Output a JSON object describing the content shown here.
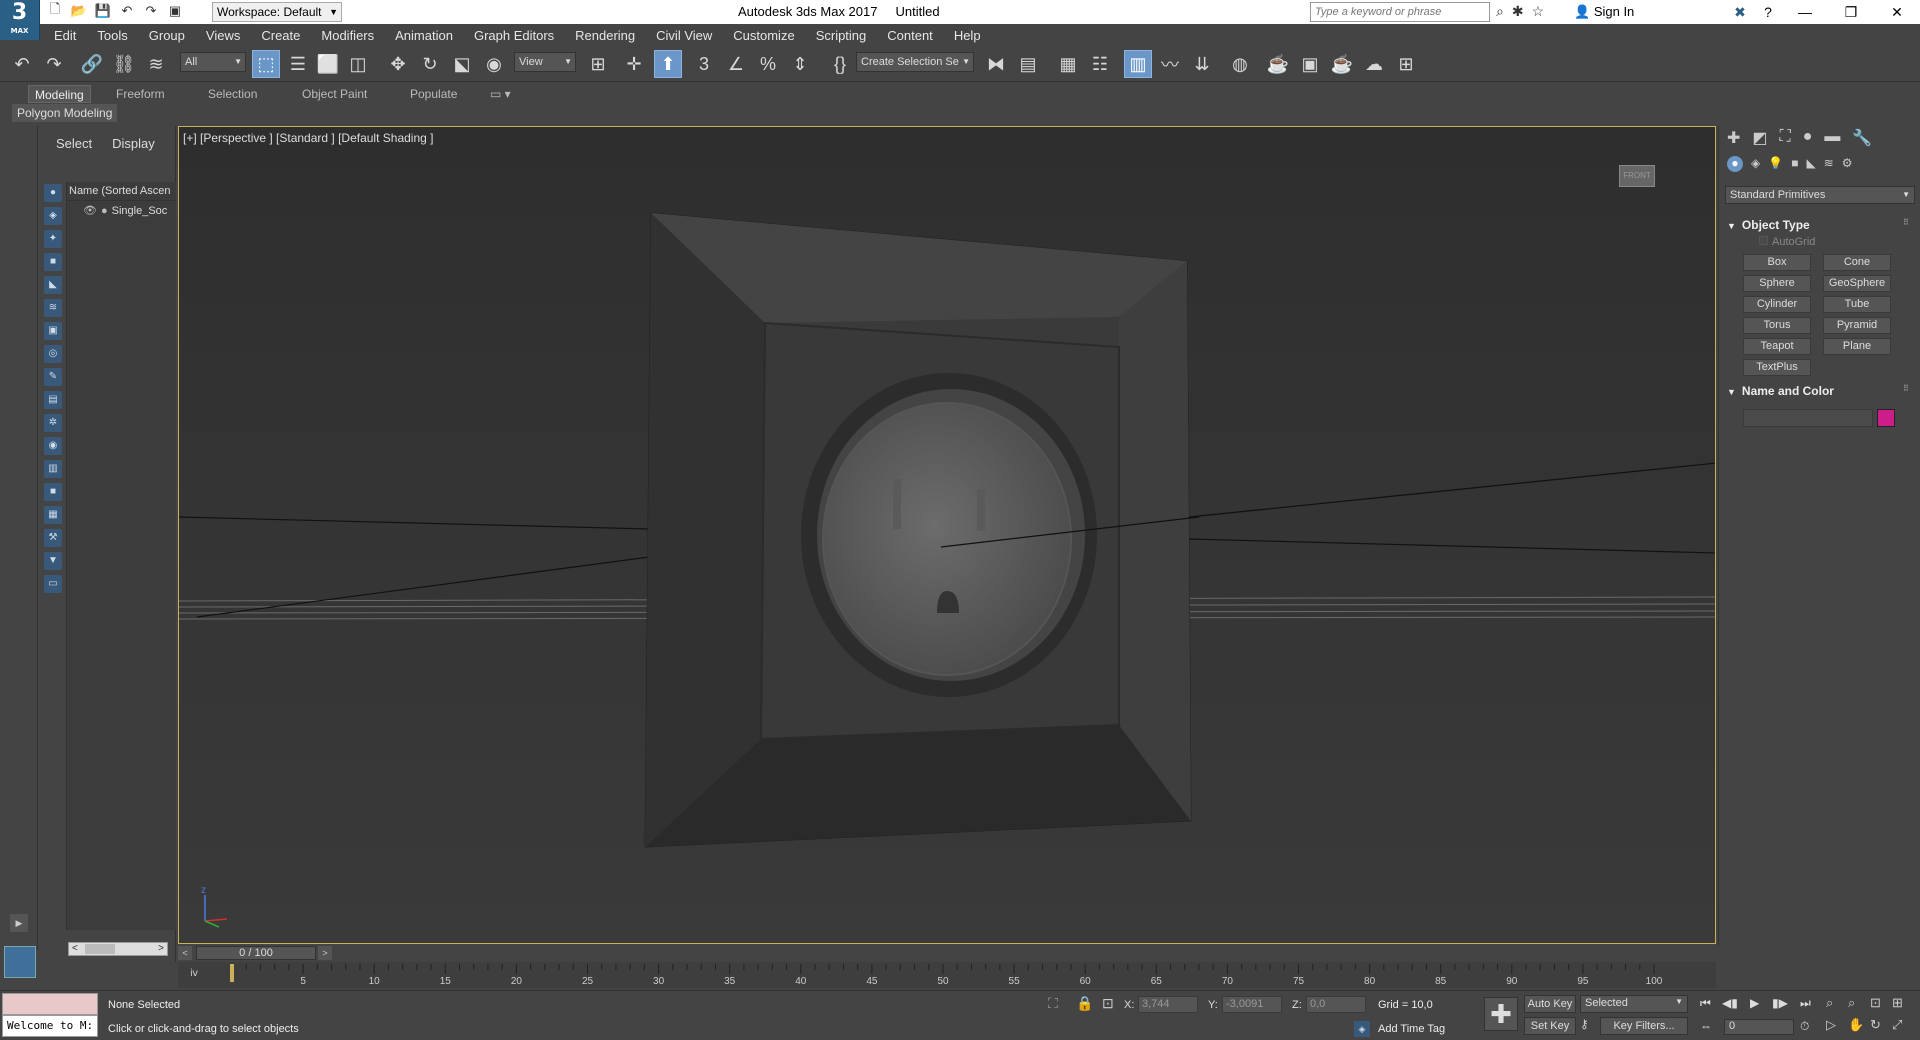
{
  "title_bar": {
    "logo_big": "3",
    "logo_small": "MAX",
    "workspace": "Workspace: Default",
    "app_title": "Autodesk 3ds Max 2017",
    "doc_title": "Untitled",
    "search_placeholder": "Type a keyword or phrase",
    "sign_in": "Sign In"
  },
  "menu": [
    "Edit",
    "Tools",
    "Group",
    "Views",
    "Create",
    "Modifiers",
    "Animation",
    "Graph Editors",
    "Rendering",
    "Civil View",
    "Customize",
    "Scripting",
    "Content",
    "Help"
  ],
  "toolbar": {
    "filter": "All",
    "ref_coord": "View",
    "selection_set": "Create Selection Se"
  },
  "ribbon": {
    "tabs": [
      "Modeling",
      "Freeform",
      "Selection",
      "Object Paint",
      "Populate"
    ],
    "sub": "Polygon Modeling"
  },
  "explorer": {
    "tabs": [
      "Select",
      "Display"
    ],
    "header": "Name (Sorted Ascen",
    "items": [
      "Single_Soc"
    ]
  },
  "viewport": {
    "label": "[+] [Perspective ] [Standard ] [Default Shading ]",
    "axis_label": "z"
  },
  "command_panel": {
    "category": "Standard Primitives",
    "object_type_title": "Object Type",
    "autogrid": "AutoGrid",
    "primitives": [
      "Box",
      "Cone",
      "Sphere",
      "GeoSphere",
      "Cylinder",
      "Tube",
      "Torus",
      "Pyramid",
      "Teapot",
      "Plane",
      "TextPlus"
    ],
    "name_color_title": "Name and Color",
    "object_color": "#cc1e8a"
  },
  "timeline": {
    "frame_display": "0 / 100",
    "ticks": [
      5,
      10,
      15,
      20,
      25,
      30,
      35,
      40,
      45,
      50,
      55,
      60,
      65,
      70,
      75,
      80,
      85,
      90,
      95,
      100
    ]
  },
  "status": {
    "welcome": "Welcome to M:",
    "selection": "None Selected",
    "prompt": "Click or click-and-drag to select objects",
    "x_label": "X:",
    "x": "3,744",
    "y_label": "Y:",
    "y": "-3,0091",
    "z_label": "Z:",
    "z": "0,0",
    "grid": "Grid = 10,0",
    "add_time_tag": "Add Time Tag",
    "auto_key": "Auto Key",
    "set_key": "Set Key",
    "selected": "Selected",
    "key_filters": "Key Filters...",
    "frame": "0"
  }
}
